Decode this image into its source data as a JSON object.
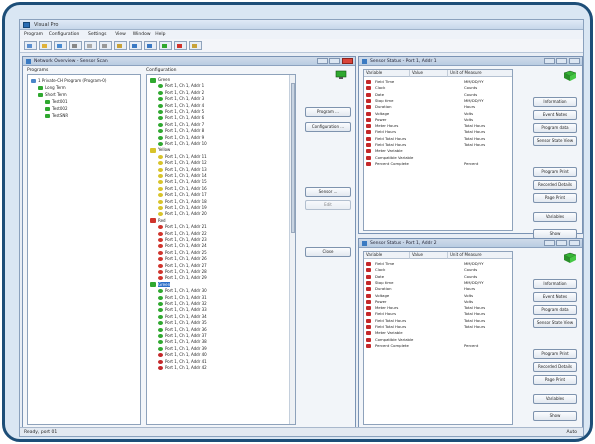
{
  "app": {
    "title": "Visual Pro"
  },
  "menu": [
    "Program",
    "Configuration",
    "Settings",
    "View",
    "Window",
    "Help"
  ],
  "toolbar": {
    "buttons": [
      "new",
      "open",
      "save",
      "print",
      "cut",
      "copy",
      "paste",
      "undo",
      "redo",
      "run",
      "stop",
      "help"
    ]
  },
  "network_window": {
    "title": "Network Overview - Sensor Scan",
    "programs_label": "Programs",
    "programs": [
      {
        "label": "1 Private-CH Program (Program-0)",
        "level": 0
      },
      {
        "label": "Long Term",
        "level": 1
      },
      {
        "label": "Short Term",
        "level": 1
      },
      {
        "label": "Test001",
        "level": 2
      },
      {
        "label": "Test002",
        "level": 2
      },
      {
        "label": "TestSNR",
        "level": 2
      }
    ],
    "configuration_label": "Configuration",
    "buttons": {
      "program": "Program ...",
      "configuration": "Configuration ...",
      "sensor": "Sensor ...",
      "edit": "Edit",
      "close": "Close"
    }
  },
  "config_groups": [
    {
      "name": "Green",
      "color": "green",
      "items": [
        "Port 1, Ch 1, Addr 1",
        "Port 1, Ch 1, Addr 2",
        "Port 1, Ch 1, Addr 3",
        "Port 1, Ch 1, Addr 4",
        "Port 1, Ch 1, Addr 5",
        "Port 1, Ch 1, Addr 6",
        "Port 1, Ch 1, Addr 7",
        "Port 1, Ch 1, Addr 8",
        "Port 1, Ch 1, Addr 9",
        "Port 1, Ch 1, Addr 10"
      ]
    },
    {
      "name": "Yellow",
      "color": "yellow",
      "items": [
        "Port 1, Ch 1, Addr 11",
        "Port 1, Ch 1, Addr 12",
        "Port 1, Ch 1, Addr 13",
        "Port 1, Ch 1, Addr 14",
        "Port 1, Ch 1, Addr 15",
        "Port 1, Ch 1, Addr 16",
        "Port 1, Ch 1, Addr 17",
        "Port 1, Ch 1, Addr 18",
        "Port 1, Ch 1, Addr 19",
        "Port 1, Ch 1, Addr 20"
      ]
    },
    {
      "name": "Red",
      "color": "red",
      "items": [
        "Port 1, Ch 1, Addr 21",
        "Port 1, Ch 1, Addr 22",
        "Port 1, Ch 1, Addr 23",
        "Port 1, Ch 1, Addr 24",
        "Port 1, Ch 1, Addr 25",
        "Port 1, Ch 1, Addr 26",
        "Port 1, Ch 1, Addr 27",
        "Port 1, Ch 1, Addr 28",
        "Port 1, Ch 1, Addr 29"
      ]
    },
    {
      "name": "Green",
      "color": "green",
      "selected": true,
      "items": [
        "Port 1, Ch 1, Addr 30",
        "Port 1, Ch 1, Addr 31",
        "Port 1, Ch 1, Addr 32",
        "Port 1, Ch 1, Addr 33",
        "Port 1, Ch 1, Addr 34",
        "Port 1, Ch 1, Addr 35",
        "Port 1, Ch 1, Addr 36",
        "Port 1, Ch 1, Addr 37",
        "Port 1, Ch 1, Addr 38",
        "Port 1, Ch 1, Addr 39"
      ]
    },
    {
      "name": "",
      "color": "redcheck",
      "items": [
        "Port 1, Ch 1, Addr 40",
        "Port 1, Ch 1, Addr 41",
        "Port 1, Ch 1, Addr 42"
      ]
    }
  ],
  "sensor_panels": [
    {
      "title": "Sensor Status - Port 1, Addr 1",
      "columns": [
        "Variable",
        "Value",
        "Unit of Measure"
      ],
      "rows": [
        [
          "Field Time",
          "",
          "MM/DD/YY"
        ],
        [
          "Clock",
          "",
          "Counts"
        ],
        [
          "Date",
          "",
          "Counts"
        ],
        [
          "Stop time",
          "",
          "MM/DD/YY"
        ],
        [
          "Duration",
          "",
          "Hours"
        ],
        [
          "Voltage",
          "",
          "Volts"
        ],
        [
          "Power",
          "",
          "Volts"
        ],
        [
          "Meter Hours",
          "",
          "Total Hours"
        ],
        [
          "Field Hours",
          "",
          "Total Hours"
        ],
        [
          "Field Total Hours",
          "",
          "Total Hours"
        ],
        [
          "Field Total Hours",
          "",
          "Total Hours"
        ],
        [
          "Meter Variable",
          "",
          ""
        ],
        [
          "Compatible Variable",
          "",
          ""
        ],
        [
          "Percent Complete",
          "",
          "Percent"
        ]
      ],
      "buttons": [
        "Information",
        "Event Notes",
        "Program data",
        "Sensor State View",
        "Program Print",
        "Recorded Details",
        "Page Print",
        "Variables",
        "Show"
      ]
    },
    {
      "title": "Sensor Status - Port 1, Addr 2",
      "columns": [
        "Variable",
        "Value",
        "Unit of Measure"
      ],
      "rows": [
        [
          "Field Time",
          "",
          "MM/DD/YY"
        ],
        [
          "Clock",
          "",
          "Counts"
        ],
        [
          "Date",
          "",
          "Counts"
        ],
        [
          "Stop time",
          "",
          "MM/DD/YY"
        ],
        [
          "Duration",
          "",
          "Hours"
        ],
        [
          "Voltage",
          "",
          "Volts"
        ],
        [
          "Power",
          "",
          "Volts"
        ],
        [
          "Meter Hours",
          "",
          "Total Hours"
        ],
        [
          "Field Hours",
          "",
          "Total Hours"
        ],
        [
          "Field Total Hours",
          "",
          "Total Hours"
        ],
        [
          "Field Total Hours",
          "",
          "Total Hours"
        ],
        [
          "Meter Variable",
          "",
          ""
        ],
        [
          "Compatible Variable",
          "",
          ""
        ],
        [
          "Percent Complete",
          "",
          "Percent"
        ]
      ],
      "buttons": [
        "Information",
        "Event Notes",
        "Program data",
        "Sensor State View",
        "Program Print",
        "Recorded Details",
        "Page Print",
        "Variables",
        "Show"
      ]
    }
  ],
  "status": {
    "left": "Ready, port 01",
    "right": "Auto"
  },
  "colors": {
    "green": "#2fa82f",
    "yellow": "#d8c32a",
    "red": "#d0342c",
    "redcheck": "#c4282a",
    "accent": "#1d4e78"
  }
}
